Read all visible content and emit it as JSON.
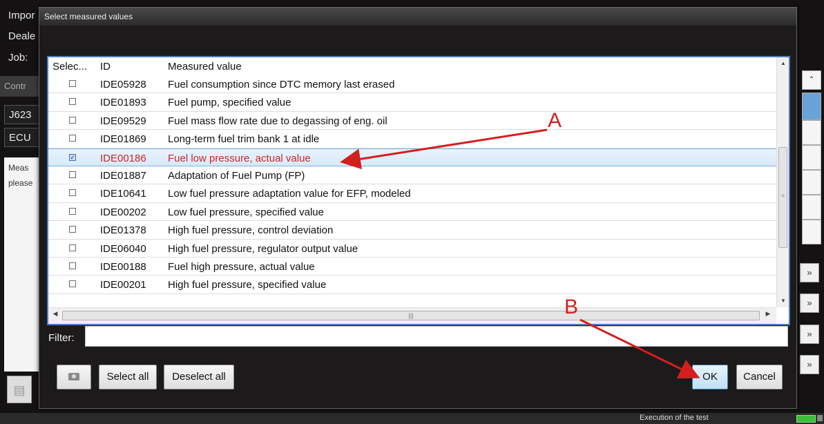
{
  "background": {
    "labels": [
      "Impor",
      "Deale",
      "Job:"
    ],
    "strip": "Contr",
    "ecu_labels": [
      "J623",
      "ECU"
    ],
    "panel_lines": [
      "Meas",
      "please"
    ]
  },
  "dialog": {
    "title": "Select measured values",
    "columns": {
      "select": "Selec...",
      "id": "ID",
      "measured_value": "Measured value"
    },
    "rows": [
      {
        "checked": false,
        "id": "IDE05928",
        "name": "Fuel consumption since DTC memory last erased"
      },
      {
        "checked": false,
        "id": "IDE01893",
        "name": "Fuel pump, specified value"
      },
      {
        "checked": false,
        "id": "IDE09529",
        "name": "Fuel mass flow rate due to degassing of eng. oil"
      },
      {
        "checked": false,
        "id": "IDE01869",
        "name": "Long-term fuel trim bank 1 at idle"
      },
      {
        "checked": true,
        "selected": true,
        "id": "IDE00186",
        "name": "Fuel low pressure, actual value"
      },
      {
        "checked": false,
        "id": "IDE01887",
        "name": "Adaptation of Fuel Pump (FP)"
      },
      {
        "checked": false,
        "id": "IDE10641",
        "name": "Low fuel pressure adaptation value for EFP, modeled"
      },
      {
        "checked": false,
        "id": "IDE00202",
        "name": "Low fuel pressure, specified value"
      },
      {
        "checked": false,
        "id": "IDE01378",
        "name": "High fuel pressure, control deviation"
      },
      {
        "checked": false,
        "id": "IDE06040",
        "name": "High fuel pressure, regulator output value"
      },
      {
        "checked": false,
        "id": "IDE00188",
        "name": "Fuel high pressure, actual value"
      },
      {
        "checked": false,
        "id": "IDE00201",
        "name": "High fuel pressure, specified value"
      }
    ],
    "filter_label": "Filter:",
    "filter_value": "",
    "buttons": {
      "select_all": "Select all",
      "deselect_all": "Deselect all",
      "ok": "OK",
      "cancel": "Cancel"
    }
  },
  "status": {
    "text": "Execution of the test"
  },
  "annotations": {
    "a": "A",
    "b": "B",
    "color": "#d41f1f"
  }
}
